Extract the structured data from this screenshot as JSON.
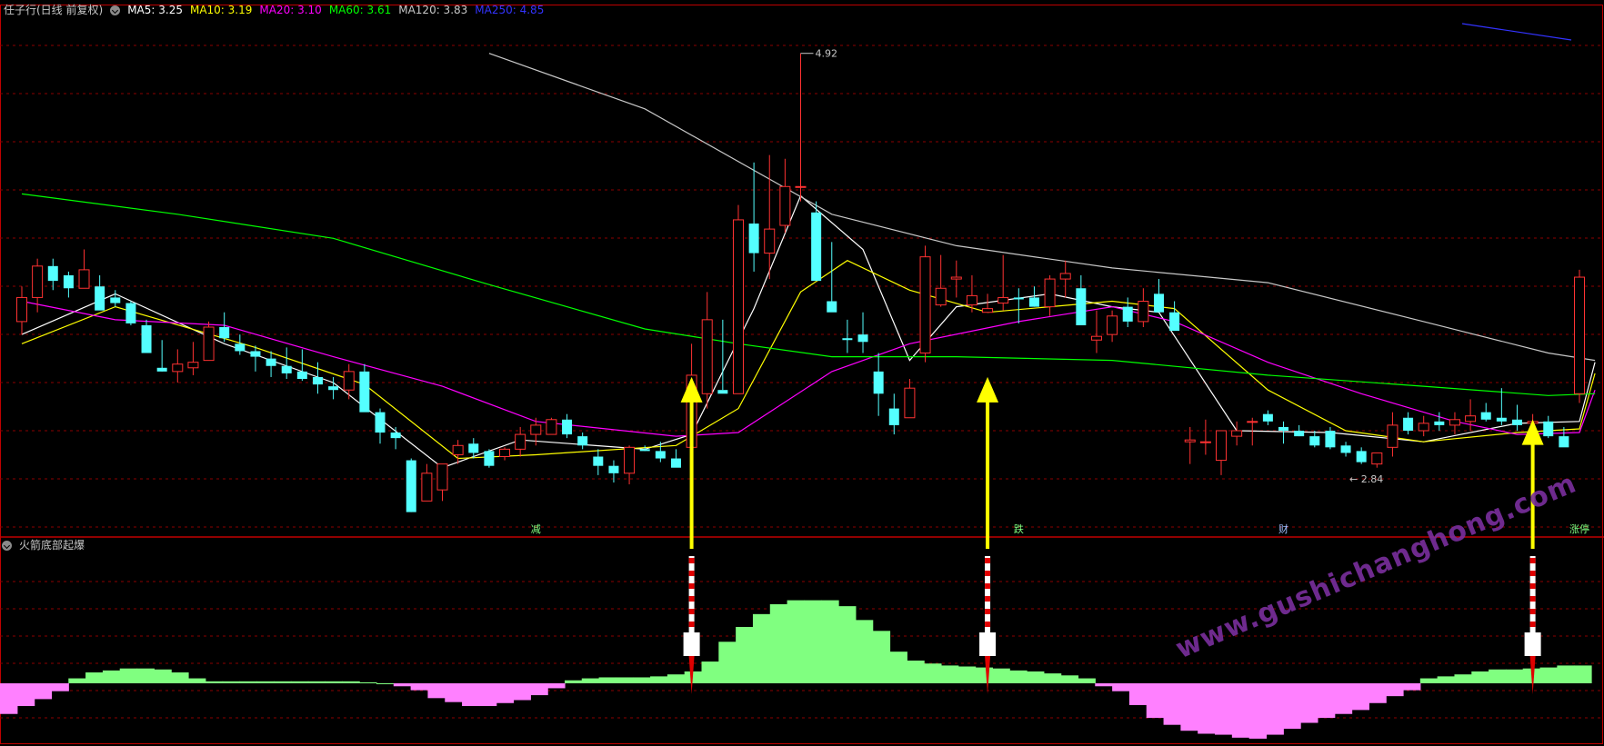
{
  "header": {
    "stock_title": "任子行(日线 前复权)",
    "ma_labels": [
      {
        "text": "MA5: 3.25",
        "color": "#ffffff"
      },
      {
        "text": "MA10: 3.19",
        "color": "#ffff00"
      },
      {
        "text": "MA20: 3.10",
        "color": "#ff00ff"
      },
      {
        "text": "MA60: 3.61",
        "color": "#00ff00"
      },
      {
        "text": "MA120: 3.83",
        "color": "#c8c8c8"
      },
      {
        "text": "MA250: 4.85",
        "color": "#3333ff"
      }
    ]
  },
  "indicator": {
    "title": "火箭底部起爆"
  },
  "watermark": "www.gushichanghong.com",
  "colors": {
    "up_candle": "#ff3232",
    "down_candle": "#54ffff",
    "grid": "#8b0000",
    "divider": "#c00000",
    "arrow": "#ffff00",
    "hist_positive": "#80ff80",
    "hist_negative": "#ff80ff"
  },
  "chart_data": [
    {
      "type": "candlestick",
      "title": "任子行(日线 前复权)",
      "price_annotations": {
        "high_label": "4.92",
        "low_label": "2.84"
      },
      "event_markers": [
        "减",
        "跌",
        "财",
        "涨停"
      ],
      "ohlc": [
        [
          3.47,
          3.66,
          3.4,
          3.6
        ],
        [
          3.6,
          3.81,
          3.52,
          3.77
        ],
        [
          3.77,
          3.81,
          3.64,
          3.69
        ],
        [
          3.72,
          3.74,
          3.6,
          3.65
        ],
        [
          3.65,
          3.86,
          3.65,
          3.75
        ],
        [
          3.66,
          3.72,
          3.57,
          3.53
        ],
        [
          3.6,
          3.64,
          3.55,
          3.57
        ],
        [
          3.57,
          3.58,
          3.45,
          3.46
        ],
        [
          3.45,
          3.48,
          3.3,
          3.3
        ],
        [
          3.22,
          3.37,
          3.2,
          3.2
        ],
        [
          3.2,
          3.32,
          3.14,
          3.24
        ],
        [
          3.22,
          3.36,
          3.18,
          3.25
        ],
        [
          3.26,
          3.47,
          3.26,
          3.44
        ],
        [
          3.44,
          3.52,
          3.36,
          3.38
        ],
        [
          3.35,
          3.4,
          3.29,
          3.31
        ],
        [
          3.31,
          3.34,
          3.2,
          3.28
        ],
        [
          3.27,
          3.31,
          3.17,
          3.23
        ],
        [
          3.23,
          3.33,
          3.16,
          3.19
        ],
        [
          3.2,
          3.32,
          3.15,
          3.16
        ],
        [
          3.17,
          3.25,
          3.08,
          3.13
        ],
        [
          3.12,
          3.17,
          3.05,
          3.1
        ],
        [
          3.1,
          3.24,
          3.05,
          3.2
        ],
        [
          3.2,
          3.24,
          3.0,
          2.98
        ],
        [
          2.98,
          3.0,
          2.81,
          2.87
        ],
        [
          2.87,
          2.9,
          2.78,
          2.84
        ],
        [
          2.72,
          2.73,
          2.44,
          2.44
        ],
        [
          2.5,
          2.7,
          2.5,
          2.65
        ],
        [
          2.56,
          2.7,
          2.5,
          2.7
        ],
        [
          2.75,
          2.83,
          2.7,
          2.8
        ],
        [
          2.81,
          2.84,
          2.73,
          2.76
        ],
        [
          2.77,
          2.78,
          2.68,
          2.69
        ],
        [
          2.74,
          2.79,
          2.72,
          2.78
        ],
        [
          2.78,
          2.9,
          2.74,
          2.86
        ],
        [
          2.86,
          2.95,
          2.8,
          2.91
        ],
        [
          2.86,
          2.95,
          2.86,
          2.94
        ],
        [
          2.94,
          2.97,
          2.84,
          2.86
        ],
        [
          2.85,
          2.87,
          2.78,
          2.8
        ],
        [
          2.74,
          2.78,
          2.64,
          2.69
        ],
        [
          2.69,
          2.72,
          2.6,
          2.65
        ],
        [
          2.65,
          2.8,
          2.59,
          2.79
        ],
        [
          2.78,
          2.8,
          2.77,
          2.77
        ],
        [
          2.77,
          2.82,
          2.71,
          2.73
        ],
        [
          2.73,
          2.78,
          2.7,
          2.68
        ],
        [
          2.79,
          3.35,
          2.78,
          3.18
        ],
        [
          3.08,
          3.63,
          3.0,
          3.48
        ],
        [
          3.1,
          3.48,
          3.1,
          3.08
        ],
        [
          3.08,
          4.1,
          3.08,
          4.02
        ],
        [
          4.0,
          4.33,
          3.74,
          3.84
        ],
        [
          3.84,
          4.37,
          3.7,
          3.97
        ],
        [
          3.99,
          4.35,
          3.95,
          4.2
        ],
        [
          4.2,
          4.92,
          4.12,
          4.2
        ],
        [
          4.06,
          4.12,
          3.7,
          3.69
        ],
        [
          3.58,
          3.9,
          3.56,
          3.52
        ],
        [
          3.38,
          3.48,
          3.3,
          3.37
        ],
        [
          3.4,
          3.52,
          3.3,
          3.36
        ],
        [
          3.2,
          3.3,
          2.96,
          3.08
        ],
        [
          3.0,
          3.08,
          2.86,
          2.91
        ],
        [
          2.95,
          3.16,
          2.95,
          3.11
        ],
        [
          3.3,
          3.88,
          3.25,
          3.82
        ],
        [
          3.56,
          3.83,
          3.55,
          3.65
        ],
        [
          3.7,
          3.8,
          3.6,
          3.71
        ],
        [
          3.56,
          3.72,
          3.52,
          3.61
        ],
        [
          3.52,
          3.62,
          3.52,
          3.54
        ],
        [
          3.57,
          3.83,
          3.53,
          3.6
        ],
        [
          3.6,
          3.65,
          3.46,
          3.59
        ],
        [
          3.6,
          3.66,
          3.55,
          3.55
        ],
        [
          3.55,
          3.72,
          3.5,
          3.7
        ],
        [
          3.7,
          3.8,
          3.6,
          3.73
        ],
        [
          3.65,
          3.72,
          3.48,
          3.45
        ],
        [
          3.37,
          3.53,
          3.3,
          3.39
        ],
        [
          3.4,
          3.53,
          3.36,
          3.5
        ],
        [
          3.55,
          3.6,
          3.44,
          3.47
        ],
        [
          3.47,
          3.65,
          3.44,
          3.58
        ],
        [
          3.62,
          3.7,
          3.55,
          3.52
        ],
        [
          3.52,
          3.58,
          3.42,
          3.42
        ],
        [
          2.82,
          2.9,
          2.7,
          2.83
        ],
        [
          2.82,
          2.94,
          2.75,
          2.82
        ],
        [
          2.72,
          2.79,
          2.64,
          2.88
        ],
        [
          2.85,
          2.93,
          2.8,
          2.88
        ],
        [
          2.93,
          2.95,
          2.8,
          2.93
        ],
        [
          2.97,
          2.99,
          2.91,
          2.93
        ],
        [
          2.9,
          2.93,
          2.81,
          2.88
        ],
        [
          2.88,
          2.91,
          2.85,
          2.85
        ],
        [
          2.85,
          2.88,
          2.79,
          2.8
        ],
        [
          2.88,
          2.9,
          2.78,
          2.79
        ],
        [
          2.8,
          2.82,
          2.74,
          2.76
        ],
        [
          2.77,
          2.79,
          2.7,
          2.71
        ],
        [
          2.7,
          2.75,
          2.68,
          2.76
        ],
        [
          2.79,
          2.98,
          2.74,
          2.91
        ],
        [
          2.95,
          2.98,
          2.86,
          2.88
        ],
        [
          2.88,
          2.96,
          2.85,
          2.92
        ],
        [
          2.93,
          2.98,
          2.88,
          2.91
        ],
        [
          2.91,
          2.98,
          2.86,
          2.94
        ],
        [
          2.93,
          3.05,
          2.88,
          2.96
        ],
        [
          2.98,
          3.03,
          2.93,
          2.94
        ],
        [
          2.95,
          3.11,
          2.91,
          2.93
        ],
        [
          2.94,
          3.02,
          2.88,
          2.91
        ],
        [
          2.92,
          2.97,
          2.88,
          2.93
        ],
        [
          2.93,
          2.96,
          2.84,
          2.85
        ],
        [
          2.85,
          2.9,
          2.8,
          2.79
        ],
        [
          3.08,
          3.75,
          3.03,
          3.71
        ]
      ],
      "series": [
        {
          "name": "MA5",
          "last": 3.25,
          "color": "#ffffff",
          "values": [
            [
              0,
              3.4
            ],
            [
              6,
              3.62
            ],
            [
              13,
              3.35
            ],
            [
              20,
              3.14
            ],
            [
              27,
              2.68
            ],
            [
              32,
              2.83
            ],
            [
              40,
              2.78
            ],
            [
              43,
              2.86
            ],
            [
              47,
              3.54
            ],
            [
              50,
              4.15
            ],
            [
              54,
              3.86
            ],
            [
              57,
              3.26
            ],
            [
              60,
              3.55
            ],
            [
              66,
              3.62
            ],
            [
              70,
              3.55
            ],
            [
              73,
              3.52
            ],
            [
              78,
              2.88
            ],
            [
              84,
              2.87
            ],
            [
              90,
              2.82
            ],
            [
              96,
              2.92
            ],
            [
              100,
              2.93
            ],
            [
              101,
              3.25
            ]
          ]
        },
        {
          "name": "MA10",
          "last": 3.19,
          "color": "#ffff00",
          "values": [
            [
              0,
              3.35
            ],
            [
              6,
              3.55
            ],
            [
              15,
              3.33
            ],
            [
              22,
              3.13
            ],
            [
              28,
              2.73
            ],
            [
              33,
              2.75
            ],
            [
              42,
              2.8
            ],
            [
              46,
              3.0
            ],
            [
              50,
              3.63
            ],
            [
              53,
              3.8
            ],
            [
              57,
              3.64
            ],
            [
              62,
              3.52
            ],
            [
              70,
              3.58
            ],
            [
              74,
              3.54
            ],
            [
              80,
              3.1
            ],
            [
              85,
              2.88
            ],
            [
              90,
              2.82
            ],
            [
              96,
              2.87
            ],
            [
              100,
              2.89
            ],
            [
              101,
              3.19
            ]
          ]
        },
        {
          "name": "MA20",
          "last": 3.1,
          "color": "#ff00ff",
          "values": [
            [
              0,
              3.58
            ],
            [
              6,
              3.48
            ],
            [
              13,
              3.45
            ],
            [
              20,
              3.28
            ],
            [
              27,
              3.12
            ],
            [
              33,
              2.93
            ],
            [
              42,
              2.85
            ],
            [
              46,
              2.87
            ],
            [
              52,
              3.2
            ],
            [
              57,
              3.35
            ],
            [
              64,
              3.47
            ],
            [
              70,
              3.55
            ],
            [
              74,
              3.47
            ],
            [
              80,
              3.25
            ],
            [
              86,
              3.08
            ],
            [
              92,
              2.93
            ],
            [
              96,
              2.86
            ],
            [
              100,
              2.87
            ],
            [
              101,
              3.1
            ]
          ]
        },
        {
          "name": "MA60",
          "last": 3.61,
          "color": "#00ff00",
          "values": [
            [
              0,
              4.16
            ],
            [
              10,
              4.05
            ],
            [
              20,
              3.92
            ],
            [
              30,
              3.67
            ],
            [
              40,
              3.43
            ],
            [
              46,
              3.35
            ],
            [
              52,
              3.28
            ],
            [
              60,
              3.28
            ],
            [
              70,
              3.26
            ],
            [
              80,
              3.18
            ],
            [
              90,
              3.12
            ],
            [
              98,
              3.07
            ],
            [
              101,
              3.08
            ]
          ]
        },
        {
          "name": "MA120",
          "last": 3.83,
          "color": "#c8c8c8",
          "values": [
            [
              30,
              4.92
            ],
            [
              40,
              4.62
            ],
            [
              52,
              4.05
            ],
            [
              60,
              3.88
            ],
            [
              70,
              3.76
            ],
            [
              80,
              3.68
            ],
            [
              90,
              3.47
            ],
            [
              98,
              3.3
            ],
            [
              101,
              3.26
            ]
          ]
        },
        {
          "name": "MA250",
          "last": 4.85,
          "color": "#3333ff",
          "values": []
        }
      ],
      "ylim": [
        2.32,
        5.12
      ]
    },
    {
      "type": "bar",
      "title": "火箭底部起爆",
      "values": [
        -0.31,
        -0.23,
        -0.16,
        -0.08,
        0.05,
        0.11,
        0.13,
        0.15,
        0.15,
        0.14,
        0.11,
        0.05,
        0.02,
        0.02,
        0.02,
        0.02,
        0.02,
        0.02,
        0.02,
        0.02,
        0.02,
        0.01,
        0.0,
        -0.03,
        -0.07,
        -0.15,
        -0.19,
        -0.23,
        -0.23,
        -0.2,
        -0.17,
        -0.12,
        -0.05,
        0.03,
        0.05,
        0.06,
        0.06,
        0.06,
        0.07,
        0.09,
        0.12,
        0.22,
        0.42,
        0.57,
        0.7,
        0.8,
        0.84,
        0.84,
        0.84,
        0.78,
        0.64,
        0.53,
        0.32,
        0.23,
        0.2,
        0.18,
        0.17,
        0.16,
        0.15,
        0.13,
        0.12,
        0.1,
        0.08,
        0.05,
        -0.03,
        -0.08,
        -0.22,
        -0.35,
        -0.42,
        -0.48,
        -0.51,
        -0.52,
        -0.55,
        -0.56,
        -0.52,
        -0.46,
        -0.4,
        -0.35,
        -0.31,
        -0.27,
        -0.2,
        -0.13,
        -0.07,
        0.05,
        0.07,
        0.09,
        0.12,
        0.14,
        0.14,
        0.15,
        0.16,
        0.18,
        0.18
      ],
      "signals": [
        43,
        62,
        97
      ],
      "ylim": [
        -0.71,
        1.22
      ]
    }
  ]
}
